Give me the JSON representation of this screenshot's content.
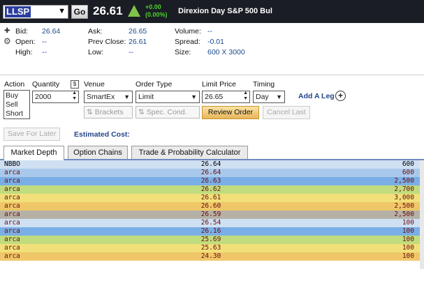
{
  "header": {
    "symbol": "LLSP",
    "go_label": "Go",
    "last_price": "26.61",
    "change": "+0.00",
    "change_pct": "(0.00%)",
    "description": "Direxion Day S&P 500 Bul",
    "colors": {
      "bar": "#1a1d24",
      "up_arrow": "#7ec34a",
      "change": "#4cd12f"
    },
    "icons": {
      "dropdown": "chevron-down-icon",
      "trend": "up-triangle-icon"
    }
  },
  "quote": {
    "bid_label": "Bid:",
    "bid": "26.64",
    "open_label": "Open:",
    "open": "--",
    "high_label": "High:",
    "high": "--",
    "ask_label": "Ask:",
    "ask": "26.65",
    "prev_close_label": "Prev Close:",
    "prev_close": "26.61",
    "low_label": "Low:",
    "low": "--",
    "volume_label": "Volume:",
    "volume": "--",
    "spread_label": "Spread:",
    "spread": "-0.01",
    "size_label": "Size:",
    "size": "600 X 3000",
    "icons": {
      "expand": "plus-icon",
      "settings": "gear-icon"
    }
  },
  "order": {
    "action_label": "Action",
    "actions": [
      "Buy",
      "Sell",
      "Short"
    ],
    "quantity_label": "Quantity",
    "dollar_icon": "$",
    "quantity": "2000",
    "venue_label": "Venue",
    "venue": "SmartEx",
    "order_type_label": "Order Type",
    "order_type": "Limit",
    "limit_price_label": "Limit Price",
    "limit_price": "26.65",
    "timing_label": "Timing",
    "timing": "Day",
    "add_leg": "Add A Leg",
    "brackets": "Brackets",
    "spec_cond": "Spec. Cond.",
    "review_order": "Review Order",
    "cancel_last": "Cancel Last",
    "save_for_later": "Save For Later",
    "estimated_cost": "Estimated Cost:"
  },
  "tabs": [
    {
      "label": "Market Depth",
      "active": true
    },
    {
      "label": "Option Chains",
      "active": false
    },
    {
      "label": "Trade & Probability Calculator",
      "active": false
    }
  ],
  "depth_rows": [
    {
      "exchange": "NBBO",
      "price": "26.64",
      "size": "600",
      "color": "#cfe0f2"
    },
    {
      "exchange": "arca",
      "price": "26.64",
      "size": "600",
      "color": "#a9c9ec"
    },
    {
      "exchange": "arca",
      "price": "26.63",
      "size": "2,500",
      "color": "#7aaee6"
    },
    {
      "exchange": "arca",
      "price": "26.62",
      "size": "2,700",
      "color": "#c0dc7e"
    },
    {
      "exchange": "arca",
      "price": "26.61",
      "size": "3,000",
      "color": "#f1e07a"
    },
    {
      "exchange": "arca",
      "price": "26.60",
      "size": "2,500",
      "color": "#efc768"
    },
    {
      "exchange": "arca",
      "price": "26.59",
      "size": "2,500",
      "color": "#b5b1a6"
    },
    {
      "exchange": "arca",
      "price": "26.54",
      "size": "100",
      "color": "#cfe0f2"
    },
    {
      "exchange": "arca",
      "price": "26.16",
      "size": "100",
      "color": "#7aaee6"
    },
    {
      "exchange": "arca",
      "price": "25.69",
      "size": "100",
      "color": "#c0dc7e"
    },
    {
      "exchange": "arca",
      "price": "25.63",
      "size": "100",
      "color": "#f1e07a"
    },
    {
      "exchange": "arca",
      "price": "24.30",
      "size": "100",
      "color": "#efc768"
    }
  ]
}
